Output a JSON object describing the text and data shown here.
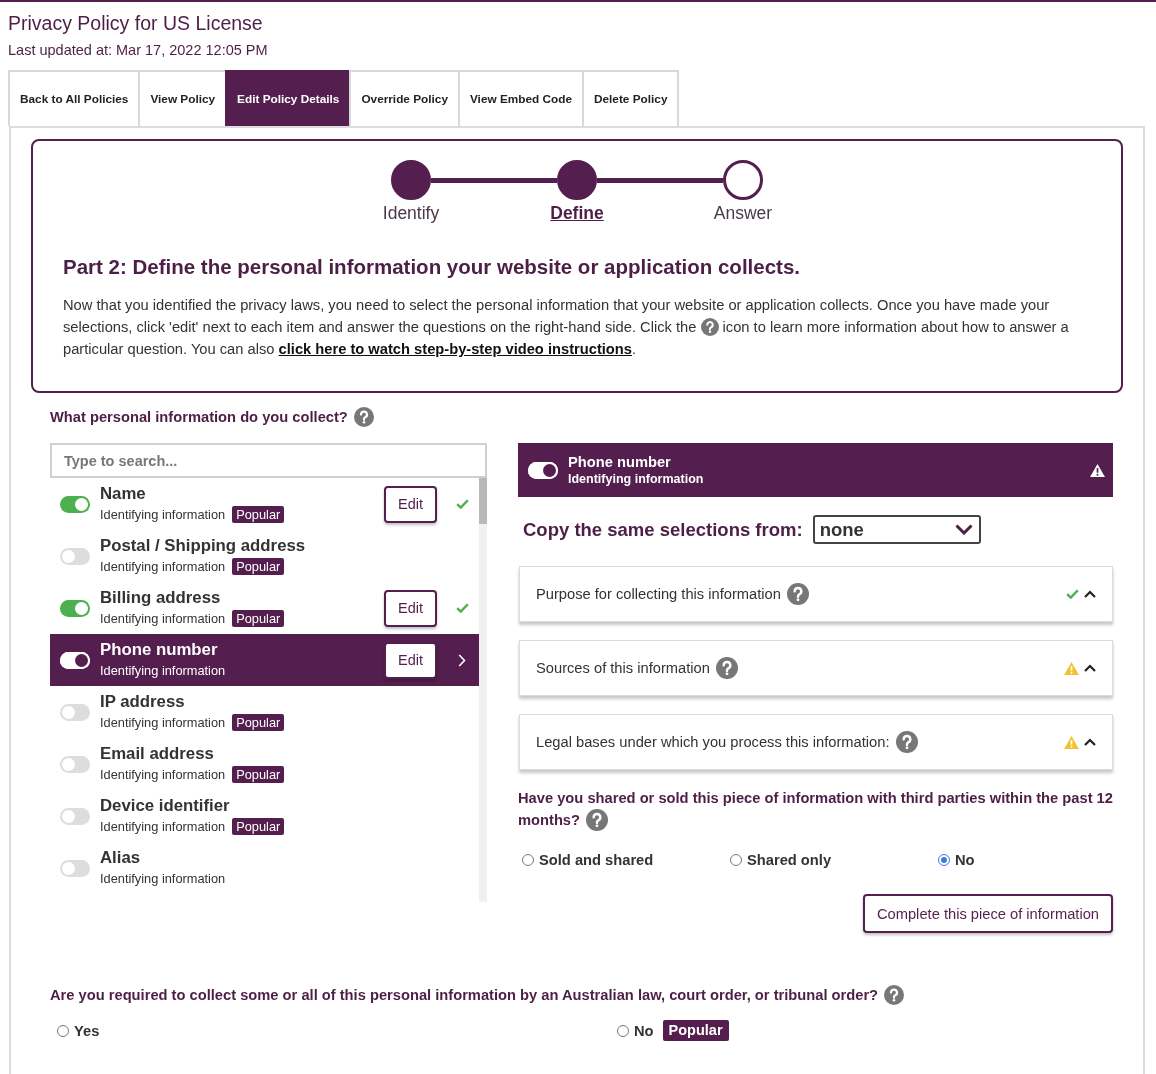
{
  "page": {
    "title": "Privacy Policy for US License",
    "last_updated": "Last updated at: Mar 17, 2022 12:05 PM"
  },
  "tabs": [
    {
      "label": "Back to All Policies",
      "selected": false
    },
    {
      "label": "View Policy",
      "selected": false
    },
    {
      "label": "Edit Policy Details",
      "selected": true
    },
    {
      "label": "Override Policy",
      "selected": false
    },
    {
      "label": "View Embed Code",
      "selected": false
    },
    {
      "label": "Delete Policy",
      "selected": false
    }
  ],
  "stepper": {
    "steps": [
      {
        "label": "Identify",
        "completed": true,
        "selected": false
      },
      {
        "label": "Define",
        "completed": true,
        "selected": true
      },
      {
        "label": "Answer",
        "completed": false,
        "selected": false
      }
    ]
  },
  "intro": {
    "heading": "Part 2: Define the personal information your website or application collects.",
    "text_before_icon": "Now that you identified the privacy laws, you need to select the personal information that your website or application collects. Once you have made your selections, click 'edit' next to each item and answer the questions on the right-hand side. Click the",
    "text_after_icon": "icon to learn more information about how to answer a particular question. You can also",
    "link": "click here to watch step-by-step video instructions",
    "text_end": "."
  },
  "collect": {
    "question": "What personal information do you collect?",
    "search": {
      "placeholder": "Type to search..."
    },
    "items": [
      {
        "name": "Name",
        "category": "Identifying information",
        "badge": "Popular",
        "on": true,
        "selected": false,
        "completed": true,
        "edit": "Edit"
      },
      {
        "name": "Postal / Shipping address",
        "category": "Identifying information",
        "badge": "Popular",
        "on": false,
        "selected": false,
        "completed": false
      },
      {
        "name": "Billing address",
        "category": "Identifying information",
        "badge": "Popular",
        "on": true,
        "selected": false,
        "completed": true,
        "edit": "Edit"
      },
      {
        "name": "Phone number",
        "category": "Identifying information",
        "on": true,
        "selected": true,
        "completed": false,
        "edit": "Edit"
      },
      {
        "name": "IP address",
        "category": "Identifying information",
        "badge": "Popular",
        "on": false,
        "selected": false,
        "completed": false
      },
      {
        "name": "Email address",
        "category": "Identifying information",
        "badge": "Popular",
        "on": false,
        "selected": false,
        "completed": false
      },
      {
        "name": "Device identifier",
        "category": "Identifying information",
        "badge": "Popular",
        "on": false,
        "selected": false,
        "completed": false
      },
      {
        "name": "Alias",
        "category": "Identifying information",
        "on": false,
        "selected": false,
        "completed": false
      }
    ]
  },
  "detail": {
    "on": true,
    "name": "Phone number",
    "category": "Identifying information",
    "warning": true,
    "copy_label": "Copy the same selections from:",
    "copy_value": "none",
    "sections": [
      {
        "title": "Purpose for collecting this information",
        "completed": true
      },
      {
        "title": "Sources of this information",
        "completed": false
      },
      {
        "title": "Legal bases under which you process this information:",
        "completed": false
      }
    ],
    "share_question": {
      "label": "Have you shared or sold this piece of information with third parties within the past 12 months?",
      "options": [
        {
          "label": "Sold and shared",
          "selected": false
        },
        {
          "label": "Shared only",
          "selected": false
        },
        {
          "label": "No",
          "selected": true
        }
      ]
    },
    "complete_button": "Complete this piece of information"
  },
  "law_question": {
    "label": "Are you required to collect some or all of this personal information by an Australian law, court order, or tribunal order?",
    "options": [
      {
        "label": "Yes",
        "selected": false
      },
      {
        "label": "No",
        "selected": false,
        "badge": "Popular"
      }
    ]
  }
}
